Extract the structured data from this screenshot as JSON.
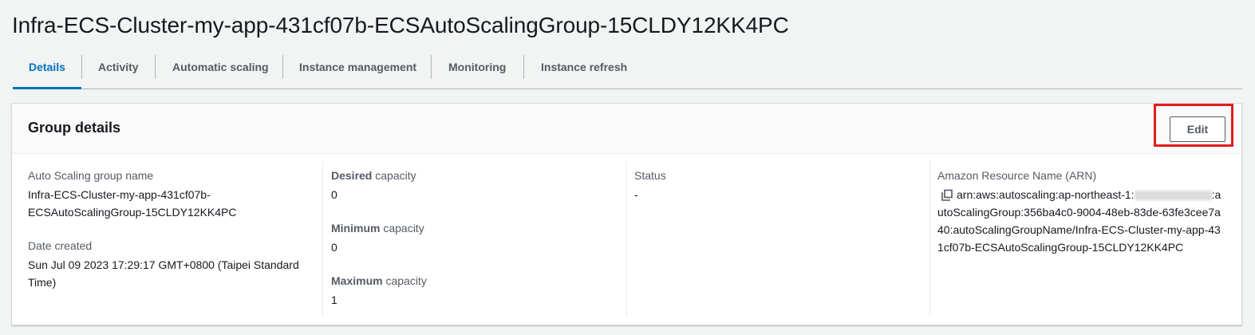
{
  "page": {
    "title": "Infra-ECS-Cluster-my-app-431cf07b-ECSAutoScalingGroup-15CLDY12KK4PC"
  },
  "tabs": [
    {
      "label": "Details",
      "active": true
    },
    {
      "label": "Activity",
      "active": false
    },
    {
      "label": "Automatic scaling",
      "active": false
    },
    {
      "label": "Instance management",
      "active": false
    },
    {
      "label": "Monitoring",
      "active": false
    },
    {
      "label": "Instance refresh",
      "active": false
    }
  ],
  "group_details": {
    "title": "Group details",
    "edit_label": "Edit",
    "name_label": "Auto Scaling group name",
    "name_value_line1": "Infra-ECS-Cluster-my-app-431cf07b-",
    "name_value_line2": "ECSAutoScalingGroup-15CLDY12KK4PC",
    "date_label": "Date created",
    "date_value_line1": "Sun Jul 09 2023 17:29:17 GMT+0800 (Taipei Standard",
    "date_value_line2": "Time)",
    "desired_label_bold": "Desired",
    "desired_label_rest": " capacity",
    "desired_value": "0",
    "minimum_label_bold": "Minimum",
    "minimum_label_rest": " capacity",
    "minimum_value": "0",
    "maximum_label_bold": "Maximum",
    "maximum_label_rest": " capacity",
    "maximum_value": "1",
    "status_label": "Status",
    "status_value": "-",
    "arn_label": "Amazon Resource Name (ARN)",
    "arn_prefix": "arn:aws:autoscaling:ap-northeast-1:",
    "arn_suffix": ":autoScalingGroup:356ba4c0-9004-48eb-83de-63fe3cee7a40:autoScalingGroupName/Infra-ECS-Cluster-my-app-431cf07b-ECSAutoScalingGroup-15CLDY12KK4PC"
  },
  "colors": {
    "accent": "#0073bb",
    "highlight": "#e21c1c"
  },
  "icons": {
    "copy": "copy-icon"
  }
}
